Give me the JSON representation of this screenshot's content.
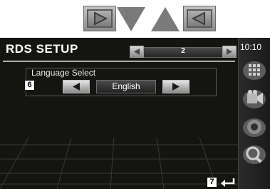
{
  "nav_arrows": [
    {
      "name": "forward-arrow-icon"
    },
    {
      "name": "down-arrow-icon"
    },
    {
      "name": "up-arrow-icon"
    },
    {
      "name": "back-arrow-icon"
    }
  ],
  "header": {
    "title": "RDS SETUP",
    "page_number": "2",
    "time": "10:10"
  },
  "language": {
    "label": "Language Select",
    "value": "English"
  },
  "callouts": {
    "language": "6",
    "return": "7"
  },
  "colors": {
    "screen_bg": "#141410",
    "text": "#ffffff"
  }
}
